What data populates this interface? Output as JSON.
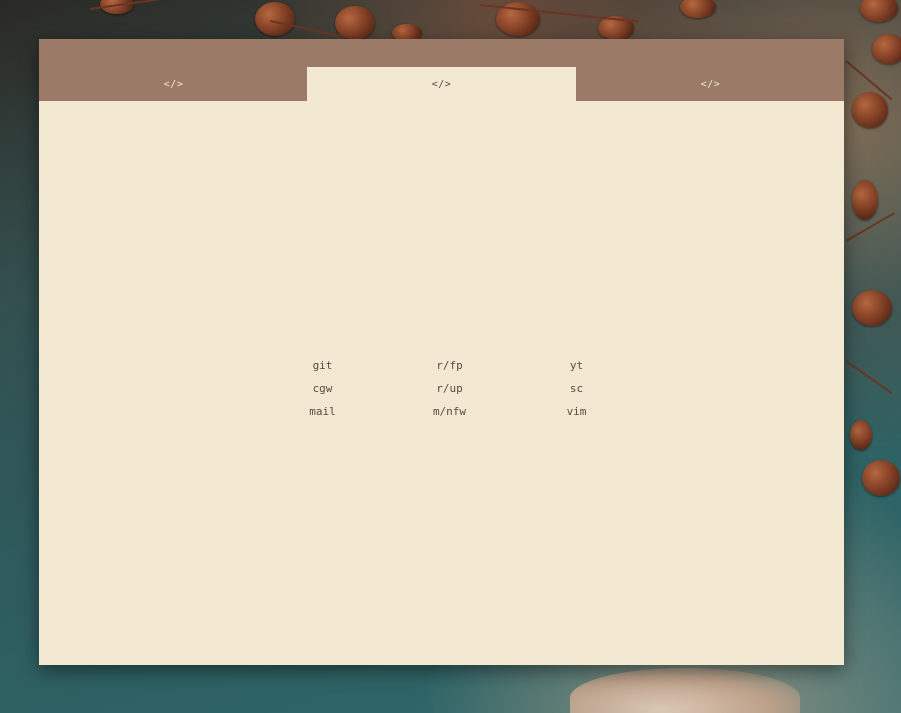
{
  "tabs": [
    {
      "label": "</>",
      "active": false
    },
    {
      "label": "</>",
      "active": true
    },
    {
      "label": "</>",
      "active": false
    }
  ],
  "links": [
    [
      "git",
      "r/fp",
      "yt"
    ],
    [
      "cgw",
      "r/up",
      "sc"
    ],
    [
      "mail",
      "m/nfw",
      "vim"
    ]
  ],
  "colors": {
    "tabbar": "#9c7a68",
    "panel": "#f3e9d3",
    "text": "#5a4a42"
  }
}
